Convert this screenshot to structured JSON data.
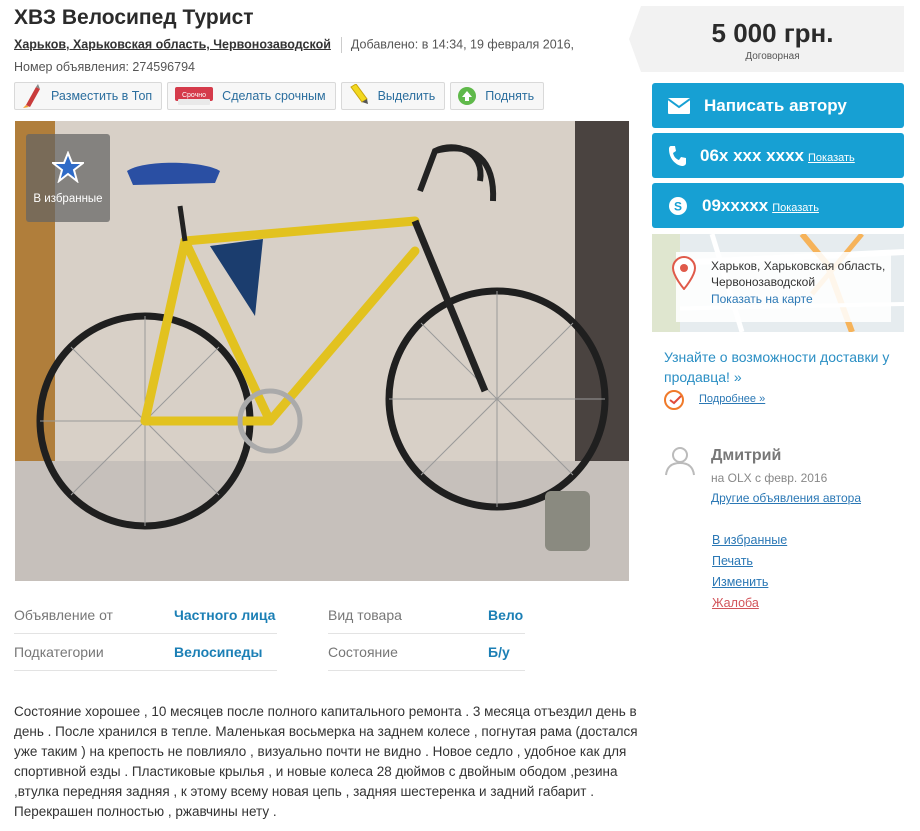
{
  "header": {
    "title": "ХВЗ Велосипед Турист",
    "location": "Харьков, Харьковская область, Червонозаводской",
    "added": "Добавлено: в 14:34, 19 февраля 2016,",
    "ad_number": "Номер объявления: 274596794"
  },
  "actions": [
    {
      "label": "Разместить в Топ",
      "icon": "rocket-icon"
    },
    {
      "label": "Сделать срочным",
      "icon": "urgent-icon",
      "badge": "Срочно"
    },
    {
      "label": "Выделить",
      "icon": "highlighter-icon"
    },
    {
      "label": "Поднять",
      "icon": "up-icon"
    }
  ],
  "photo": {
    "favorite_label": "В избранные"
  },
  "details": {
    "row1": {
      "label": "Объявление от",
      "value": "Частного лица"
    },
    "row2": {
      "label": "Вид товара",
      "value": "Вело"
    },
    "row3": {
      "label": "Подкатегории",
      "value": "Велосипеды"
    },
    "row4": {
      "label": "Состояние",
      "value": "Б/у"
    }
  },
  "description": "Состояние хорошее , 10 месяцев после полного капитального ремонта . 3 месяца отъездил день в день . После хранился в тепле. Маленькая восьмерка на заднем колесе , погнутая рама (достался уже таким ) на крепость не повлияло , визуально почти не видно . Новое седло , удобное как для спортивной езды . Пластиковые крылья , и новые колеса 28 дюймов с двойным ободом ,резина ,втулка передняя задняя , к этому всему новая цепь , задняя шестеренка и задний габарит . Перекрашен полностью , ржавчины нету .",
  "sidebar": {
    "price": "5 000 грн.",
    "price_note": "Договорная",
    "contact_author": "Написать автору",
    "phone": "06x xxx xxxx",
    "phone_show": "Показать",
    "skype": "09xxxxx",
    "skype_show": "Показать",
    "map_address": "Харьков, Харьковская область, Червонозаводской",
    "map_link": "Показать на карте",
    "delivery": "Узнайте о возможности доставки у продавца! »",
    "delivery_more": "Подробнее »",
    "user_name": "Дмитрий",
    "user_since": "на OLX с февр. 2016",
    "user_other": "Другие объявления автора",
    "links": {
      "favorites": "В избранные",
      "print": "Печать",
      "edit": "Изменить",
      "complaint": "Жалоба"
    }
  },
  "colors": {
    "accent": "#17a0d3",
    "link": "#2b78b5",
    "complaint": "#d2545a"
  }
}
